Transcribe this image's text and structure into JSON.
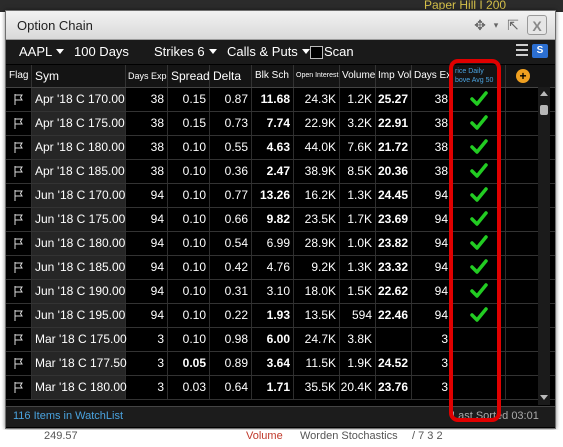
{
  "background": {
    "top_text": "Paper Hill I 200",
    "bottom_texts": [
      "249.57",
      "Volume",
      "Worden Stochastics",
      "/ 7 3 2"
    ]
  },
  "window": {
    "title": "Option Chain"
  },
  "toolbar": {
    "symbol": "AAPL",
    "days": "100 Days",
    "strikes": "Strikes 6",
    "type": "Calls & Puts",
    "scan_label": "Scan",
    "s_label": "S"
  },
  "columns": {
    "flag": "Flag",
    "sym": "Sym",
    "days_exp": "Days Exp",
    "spread": "Spread",
    "delta": "Delta",
    "blk_sch": "Blk Sch",
    "open_interest": "Open Interest",
    "volume": "Volume",
    "imp_vol": "Imp Vol",
    "days_exp2": "Days Exp",
    "custom_line1": "rice Daily",
    "custom_line2": "bove Avg 50"
  },
  "rows": [
    {
      "sym": "Apr '18 C 170.00",
      "days_exp": "38",
      "spread": "0.15",
      "delta": "0.87",
      "blk": "11.68",
      "oi": "24.3K",
      "vol": "1.2K",
      "iv": "25.27",
      "days_exp2": "38",
      "check": true
    },
    {
      "sym": "Apr '18 C 175.00",
      "days_exp": "38",
      "spread": "0.15",
      "delta": "0.73",
      "blk": "7.74",
      "oi": "22.9K",
      "vol": "3.2K",
      "iv": "22.91",
      "days_exp2": "38",
      "check": true
    },
    {
      "sym": "Apr '18 C 180.00",
      "days_exp": "38",
      "spread": "0.10",
      "delta": "0.55",
      "blk": "4.63",
      "oi": "44.0K",
      "vol": "7.6K",
      "iv": "21.72",
      "days_exp2": "38",
      "check": true
    },
    {
      "sym": "Apr '18 C 185.00",
      "days_exp": "38",
      "spread": "0.10",
      "delta": "0.36",
      "blk": "2.47",
      "oi": "38.9K",
      "vol": "8.5K",
      "iv": "20.36",
      "days_exp2": "38",
      "check": true
    },
    {
      "sym": "Jun '18 C 170.00",
      "days_exp": "94",
      "spread": "0.10",
      "delta": "0.77",
      "blk": "13.26",
      "oi": "16.2K",
      "vol": "1.3K",
      "iv": "24.45",
      "days_exp2": "94",
      "check": true
    },
    {
      "sym": "Jun '18 C 175.00",
      "days_exp": "94",
      "spread": "0.10",
      "delta": "0.66",
      "blk": "9.82",
      "oi": "23.5K",
      "vol": "1.7K",
      "iv": "23.69",
      "days_exp2": "94",
      "check": true
    },
    {
      "sym": "Jun '18 C 180.00",
      "days_exp": "94",
      "spread": "0.10",
      "delta": "0.54",
      "blk": "6.99",
      "oi": "28.9K",
      "vol": "1.0K",
      "iv": "23.82",
      "days_exp2": "94",
      "check": true
    },
    {
      "sym": "Jun '18 C 185.00",
      "days_exp": "94",
      "spread": "0.10",
      "delta": "0.42",
      "blk": "4.76",
      "oi": "9.2K",
      "vol": "1.3K",
      "iv": "23.32",
      "days_exp2": "94",
      "check": true
    },
    {
      "sym": "Jun '18 C 190.00",
      "days_exp": "94",
      "spread": "0.10",
      "delta": "0.31",
      "blk": "3.10",
      "oi": "18.0K",
      "vol": "1.5K",
      "iv": "22.62",
      "days_exp2": "94",
      "check": true
    },
    {
      "sym": "Jun '18 C 195.00",
      "days_exp": "94",
      "spread": "0.10",
      "delta": "0.22",
      "blk": "1.93",
      "oi": "13.5K",
      "vol": "594",
      "iv": "22.46",
      "days_exp2": "94",
      "check": true
    },
    {
      "sym": "Mar '18 C 175.00",
      "days_exp": "3",
      "spread": "0.10",
      "delta": "0.98",
      "blk": "6.00",
      "oi": "24.7K",
      "vol": "3.8K",
      "iv": "",
      "days_exp2": "3",
      "check": false
    },
    {
      "sym": "Mar '18 C 177.50",
      "days_exp": "3",
      "spread": "0.05",
      "delta": "0.89",
      "blk": "3.64",
      "oi": "11.5K",
      "vol": "1.9K",
      "iv": "24.52",
      "days_exp2": "3",
      "check": false
    },
    {
      "sym": "Mar '18 C 180.00",
      "days_exp": "3",
      "spread": "0.03",
      "delta": "0.64",
      "blk": "1.71",
      "oi": "35.5K",
      "vol": "20.4K",
      "iv": "23.76",
      "days_exp2": "3",
      "check": false
    }
  ],
  "status": {
    "items_text": "116 Items in WatchList",
    "sort_text": "Last Sorted 03:01"
  },
  "colors": {
    "highlight": "#e00000",
    "check": "#22cc22",
    "accent": "#2c6fd1"
  }
}
